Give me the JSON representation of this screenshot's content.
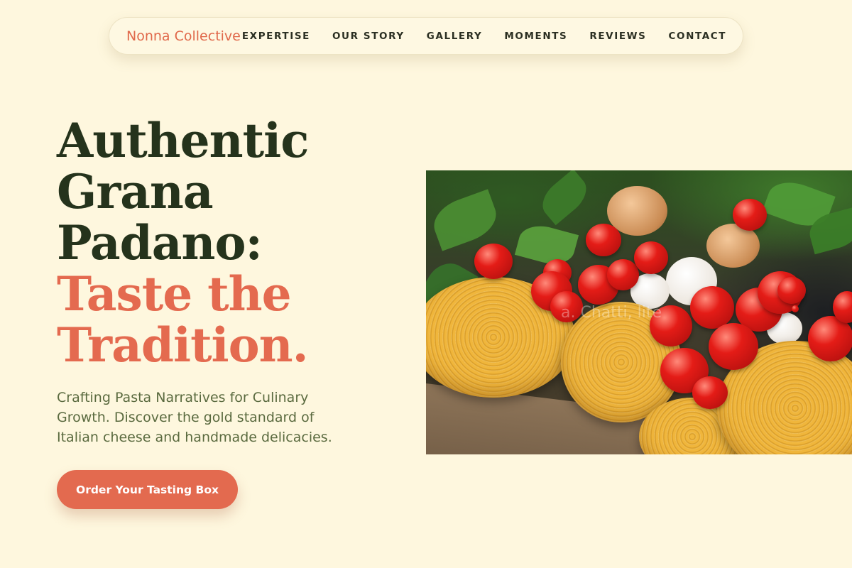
{
  "brand": {
    "name": "Nonna Collective"
  },
  "nav": {
    "links": [
      {
        "label": "EXPERTISE"
      },
      {
        "label": "OUR STORY"
      },
      {
        "label": "GALLERY"
      },
      {
        "label": "MOMENTS"
      },
      {
        "label": "REVIEWS"
      },
      {
        "label": "CONTACT"
      }
    ]
  },
  "hero": {
    "headline_lines": [
      "Authentic",
      "Grana",
      "Padano:"
    ],
    "headline_accent_lines": [
      "Taste the",
      "Tradition."
    ],
    "subtitle": "Crafting Pasta Narratives for Culinary Growth. Discover the gold standard of Italian cheese and handmade delicacies.",
    "cta_label": "Order Your Tasting Box",
    "image_watermark": "a. Chatti, lite"
  },
  "colors": {
    "background": "#fef7de",
    "accent": "#e46a4f",
    "heading_dark": "#25331c",
    "subtitle_text": "#5a6a3f"
  }
}
